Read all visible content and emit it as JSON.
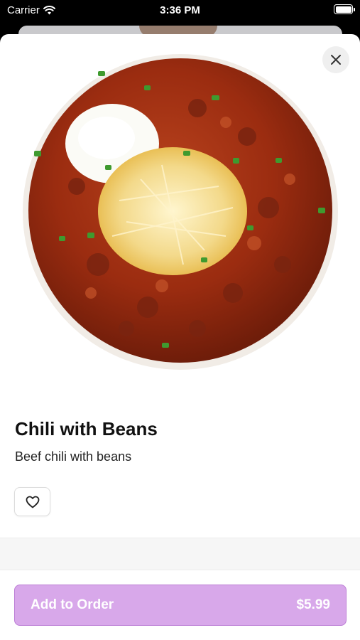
{
  "status_bar": {
    "carrier": "Carrier",
    "time": "3:36 PM"
  },
  "icons": {
    "wifi": "wifi-icon",
    "battery": "battery-icon",
    "close": "close-icon",
    "heart": "heart-icon"
  },
  "item": {
    "name": "Chili with Beans",
    "description": "Beef chili with beans"
  },
  "order_button": {
    "label": "Add to Order",
    "price": "$5.99"
  },
  "colors": {
    "accent": "#d8a8ea",
    "accent_border": "#bc7ed6",
    "chili": "#9b2c10"
  }
}
